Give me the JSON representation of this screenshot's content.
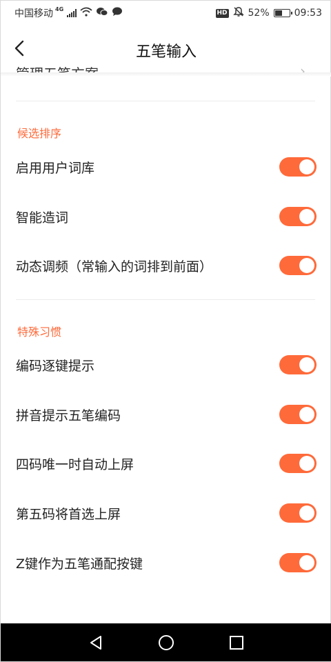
{
  "status_bar": {
    "carrier": "中国移动",
    "network": "4G",
    "hd_badge": "HD",
    "battery_percent": "52%",
    "battery_level": 0.52,
    "time": "09:53",
    "icons": [
      "signal-icon",
      "wifi-icon",
      "wechat-icon",
      "message-icon",
      "mute-icon",
      "battery-icon"
    ]
  },
  "header": {
    "title": "五笔输入",
    "back_icon": "back-arrow-icon"
  },
  "scrolled_row": {
    "partial_label": "管理五笔方案",
    "chevron": "›"
  },
  "sections": [
    {
      "title": "候选排序",
      "items": [
        {
          "label": "启用用户词库",
          "enabled": true
        },
        {
          "label": "智能造词",
          "enabled": true
        },
        {
          "label": "动态调频（常输入的词排到前面）",
          "enabled": true
        }
      ]
    },
    {
      "title": "特殊习惯",
      "items": [
        {
          "label": "编码逐键提示",
          "enabled": true
        },
        {
          "label": "拼音提示五笔编码",
          "enabled": true
        },
        {
          "label": "四码唯一时自动上屏",
          "enabled": true
        },
        {
          "label": "第五码将首选上屏",
          "enabled": true
        },
        {
          "label": "Z键作为五笔通配按键",
          "enabled": true
        }
      ]
    }
  ],
  "colors": {
    "accent": "#ff6a3a",
    "navbar": "#000000"
  },
  "nav_bar": {
    "buttons": [
      "back-triangle-icon",
      "home-circle-icon",
      "recents-square-icon"
    ]
  }
}
